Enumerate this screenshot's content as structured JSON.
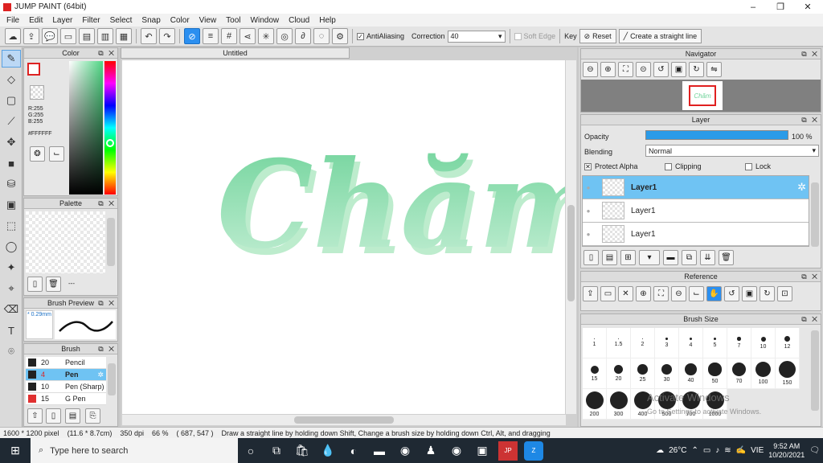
{
  "app": {
    "title": "JUMP PAINT (64bit)"
  },
  "menu": [
    "File",
    "Edit",
    "Layer",
    "Filter",
    "Select",
    "Snap",
    "Color",
    "View",
    "Tool",
    "Window",
    "Cloud",
    "Help"
  ],
  "toolbar": {
    "antialiasing_label": "AntiAliasing",
    "correction_label": "Correction",
    "correction_value": "40",
    "soft_edge_label": "Soft Edge",
    "key_label": "Key",
    "reset_label": "Reset",
    "straight_line_label": "Create a straight line"
  },
  "color_panel": {
    "title": "Color",
    "r": "R:255",
    "g": "G:255",
    "b": "B:255",
    "hex": "#FFFFFF",
    "primary": "#ffffff",
    "secondary": "#f59ec2"
  },
  "palette_panel": {
    "title": "Palette",
    "extra": "---"
  },
  "brush_preview": {
    "title": "Brush Preview",
    "size": "* 0.29mm"
  },
  "brush_panel": {
    "title": "Brush",
    "items": [
      {
        "size": "20",
        "name": "Pencil",
        "color": "#222222"
      },
      {
        "size": "4",
        "name": "Pen",
        "color": "#222222"
      },
      {
        "size": "10",
        "name": "Pen (Sharp)",
        "color": "#222222"
      },
      {
        "size": "15",
        "name": "G Pen",
        "color": "#e03030"
      }
    ]
  },
  "document": {
    "tab": "Untitled",
    "art_text": "Chăm"
  },
  "navigator": {
    "title": "Navigator",
    "thumb_text": "Chăm"
  },
  "layer_panel": {
    "title": "Layer",
    "opacity_label": "Opacity",
    "opacity_value": "100 %",
    "opacity_fraction": 1.0,
    "blending_label": "Blending",
    "blending_value": "Normal",
    "protect_alpha_label": "Protect Alpha",
    "clipping_label": "Clipping",
    "lock_label": "Lock",
    "layers": [
      "Layer1",
      "Layer1",
      "Layer1"
    ]
  },
  "reference": {
    "title": "Reference"
  },
  "brush_size": {
    "title": "Brush Size",
    "sizes": [
      "1",
      "1.5",
      "2",
      "3",
      "4",
      "5",
      "7",
      "10",
      "12",
      "15",
      "20",
      "25",
      "30",
      "40",
      "50",
      "70",
      "100",
      "150",
      "200",
      "300",
      "400",
      "500",
      "700",
      "1000"
    ],
    "watermark1": "Activate Windows",
    "watermark2": "Go to Settings to activate Windows."
  },
  "status": {
    "size": "1600 * 1200 pixel",
    "physical": "(11.6 * 8.7cm)",
    "dpi": "350 dpi",
    "zoom": "66 %",
    "coords": "( 687, 547 )",
    "hint": "Draw a straight line by holding down Shift, Change a brush size by holding down Ctrl, Alt, and dragging"
  },
  "taskbar": {
    "search_placeholder": "Type here to search",
    "weather": "26°C",
    "lang": "VIE",
    "time": "9:52 AM",
    "date": "10/20/2021"
  },
  "colors": {
    "accent": "#2b8ff0",
    "selection": "#6fc3f3",
    "art_green": "#7fd6a0"
  }
}
